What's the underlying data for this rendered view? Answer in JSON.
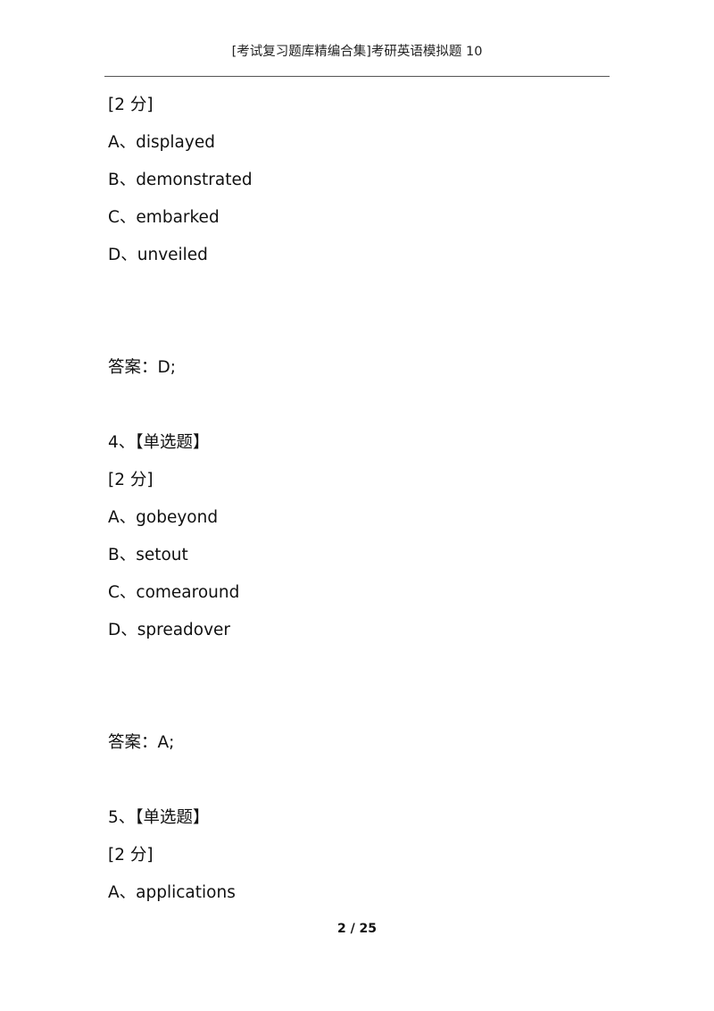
{
  "header": {
    "title": "[考试复习题库精编合集]考研英语模拟题 10"
  },
  "question3_tail": {
    "score": "[2 分]",
    "options": [
      "A、displayed",
      "B、demonstrated",
      "C、embarked",
      "D、unveiled"
    ],
    "answer": "答案：D;"
  },
  "question4": {
    "title": "4、【单选题】",
    "score": "[2 分]",
    "options": [
      "A、gobeyond",
      "B、setout",
      "C、comearound",
      "D、spreadover"
    ],
    "answer": "答案：A;"
  },
  "question5": {
    "title": "5、【单选题】",
    "score": "[2 分]",
    "options": [
      "A、applications"
    ]
  },
  "footer": {
    "page_indicator": "2 / 25"
  }
}
